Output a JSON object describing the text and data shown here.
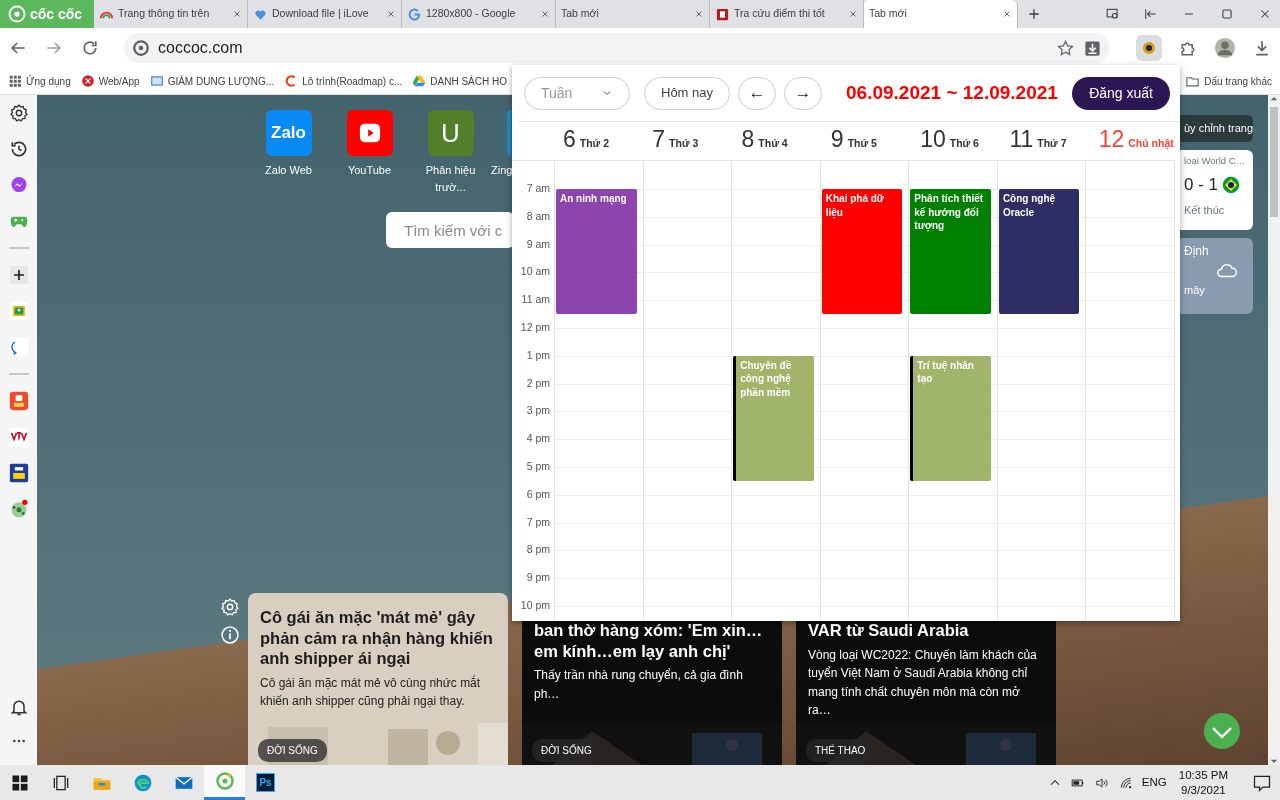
{
  "browser": {
    "logo_text": "cốc cốc",
    "tabs": [
      {
        "title": "Trang thông tin trên",
        "kind": "rainbow",
        "selected": false
      },
      {
        "title": "Download file | iLove",
        "kind": "heart",
        "selected": false
      },
      {
        "title": "1280x800 - Google",
        "kind": "google",
        "selected": false
      },
      {
        "title": "Tab mới",
        "kind": "none",
        "selected": false
      },
      {
        "title": "Tra cứu điểm thi tốt",
        "kind": "book",
        "selected": false
      },
      {
        "title": "Tab mới",
        "kind": "none",
        "selected": true
      }
    ],
    "address": "coccoc.com",
    "bookmarks": [
      {
        "label": "Ứng dụng",
        "kind": "apps"
      },
      {
        "label": "Web/App",
        "kind": "x"
      },
      {
        "label": "GIẢM DUNG LƯỢNG..."
      },
      {
        "label": "Lô trình(Roadmap) c...",
        "kind": "c"
      },
      {
        "label": "DANH SÁCH HO",
        "kind": "drive"
      }
    ],
    "other_bookmarks": "Dấu trang khác"
  },
  "new_tab": {
    "shortcuts": [
      {
        "kind": "zalo",
        "icon_text": "Zalo",
        "label": "Zalo Web"
      },
      {
        "kind": "youtube",
        "label": "YouTube"
      },
      {
        "kind": "letter",
        "icon_text": "U",
        "label": "Phân hiệu trườ..."
      },
      {
        "kind": "zing",
        "label": "Zing"
      }
    ],
    "search": {
      "placeholder": "Tìm kiếm với c"
    },
    "customize": "ùy chỉnh trang",
    "match": {
      "title": "loại World C…",
      "score": "0 - 1",
      "status": "Kết thúc"
    },
    "weather": {
      "place": "Định",
      "condition": "mây"
    },
    "news": [
      {
        "kind": "light",
        "title": "Cô gái ăn mặc 'mát mẻ' gây phản cảm ra nhận hàng khiến anh shipper ái ngại",
        "summary": "Cô gái ăn mặc mát mẻ vô cùng nhức mắt khiến anh shipper cũng phải ngại thay.",
        "tag": "ĐỜI SỐNG"
      },
      {
        "kind": "dark",
        "title": "ban thờ hàng xóm: 'Em xin… em kính…em lạy anh chị'",
        "summary": "Thấy trần nhà rung chuyển, cả gia đình ph…",
        "tag": "ĐỜI SỐNG"
      },
      {
        "kind": "dark",
        "title": "VAR từ Saudi Arabia",
        "summary": "Vòng loại WC2022: Chuyến làm khách của tuyển Việt Nam ở Saudi Arabia không chỉ mang tính chất chuyên môn mà còn mở ra…",
        "tag": "THỂ THAO"
      }
    ]
  },
  "calendar": {
    "view": "Tuần",
    "today": "Hôm nay",
    "prev": "←",
    "next": "→",
    "range": "06.09.2021 ~ 12.09.2021",
    "logout": "Đăng xuất",
    "hours": [
      "7 am",
      "8 am",
      "9 am",
      "10 am",
      "11 am",
      "12 pm",
      "1 pm",
      "2 pm",
      "3 pm",
      "4 pm",
      "5 pm",
      "6 pm",
      "7 pm",
      "8 pm",
      "9 pm",
      "10 pm"
    ],
    "days": [
      {
        "number": "6",
        "name": "Thứ 2",
        "highlighted": false,
        "events": [
          {
            "title": "An ninh mạng",
            "kind": "morning",
            "color": "#8e44ad",
            "left_bar": false
          }
        ]
      },
      {
        "number": "7",
        "name": "Thứ 3",
        "highlighted": false
      },
      {
        "number": "8",
        "name": "Thứ 4",
        "highlighted": false,
        "events": [
          {
            "title": "Chuyên đề công nghệ phần mềm",
            "kind": "afternoon",
            "color": "#a0b46a",
            "left_bar": true
          }
        ]
      },
      {
        "number": "9",
        "name": "Thứ 5",
        "highlighted": false,
        "events": [
          {
            "title": "Khai phá dữ liệu",
            "kind": "morning",
            "color": "#ff0000",
            "left_bar": false
          }
        ]
      },
      {
        "number": "10",
        "name": "Thứ 6",
        "highlighted": false,
        "events": [
          {
            "title": "Phân tích thiết kế hướng đối tượng",
            "kind": "morning",
            "color": "#008000",
            "left_bar": false
          },
          {
            "title": "Trí tuệ nhân tạo",
            "kind": "afternoon",
            "color": "#a0b46a",
            "left_bar": true
          }
        ]
      },
      {
        "number": "11",
        "name": "Thứ 7",
        "highlighted": false,
        "events": [
          {
            "title": "Công nghệ Oracle",
            "kind": "morning",
            "color": "#2e2d66",
            "left_bar": false
          }
        ]
      },
      {
        "number": "12",
        "name": "Chủ nhật",
        "highlighted": true
      }
    ]
  },
  "taskbar": {
    "apps": [
      {
        "kind": "start",
        "selected": false
      },
      {
        "kind": "taskview",
        "selected": false
      },
      {
        "kind": "explorer",
        "selected": false
      },
      {
        "kind": "edge",
        "selected": false
      },
      {
        "kind": "mail",
        "selected": false
      },
      {
        "kind": "coccoc",
        "selected": true
      },
      {
        "kind": "photoshop",
        "icon_text": "Ps",
        "selected": false
      }
    ],
    "language": "ENG",
    "time": "10:35 PM",
    "date": "9/3/2021"
  }
}
